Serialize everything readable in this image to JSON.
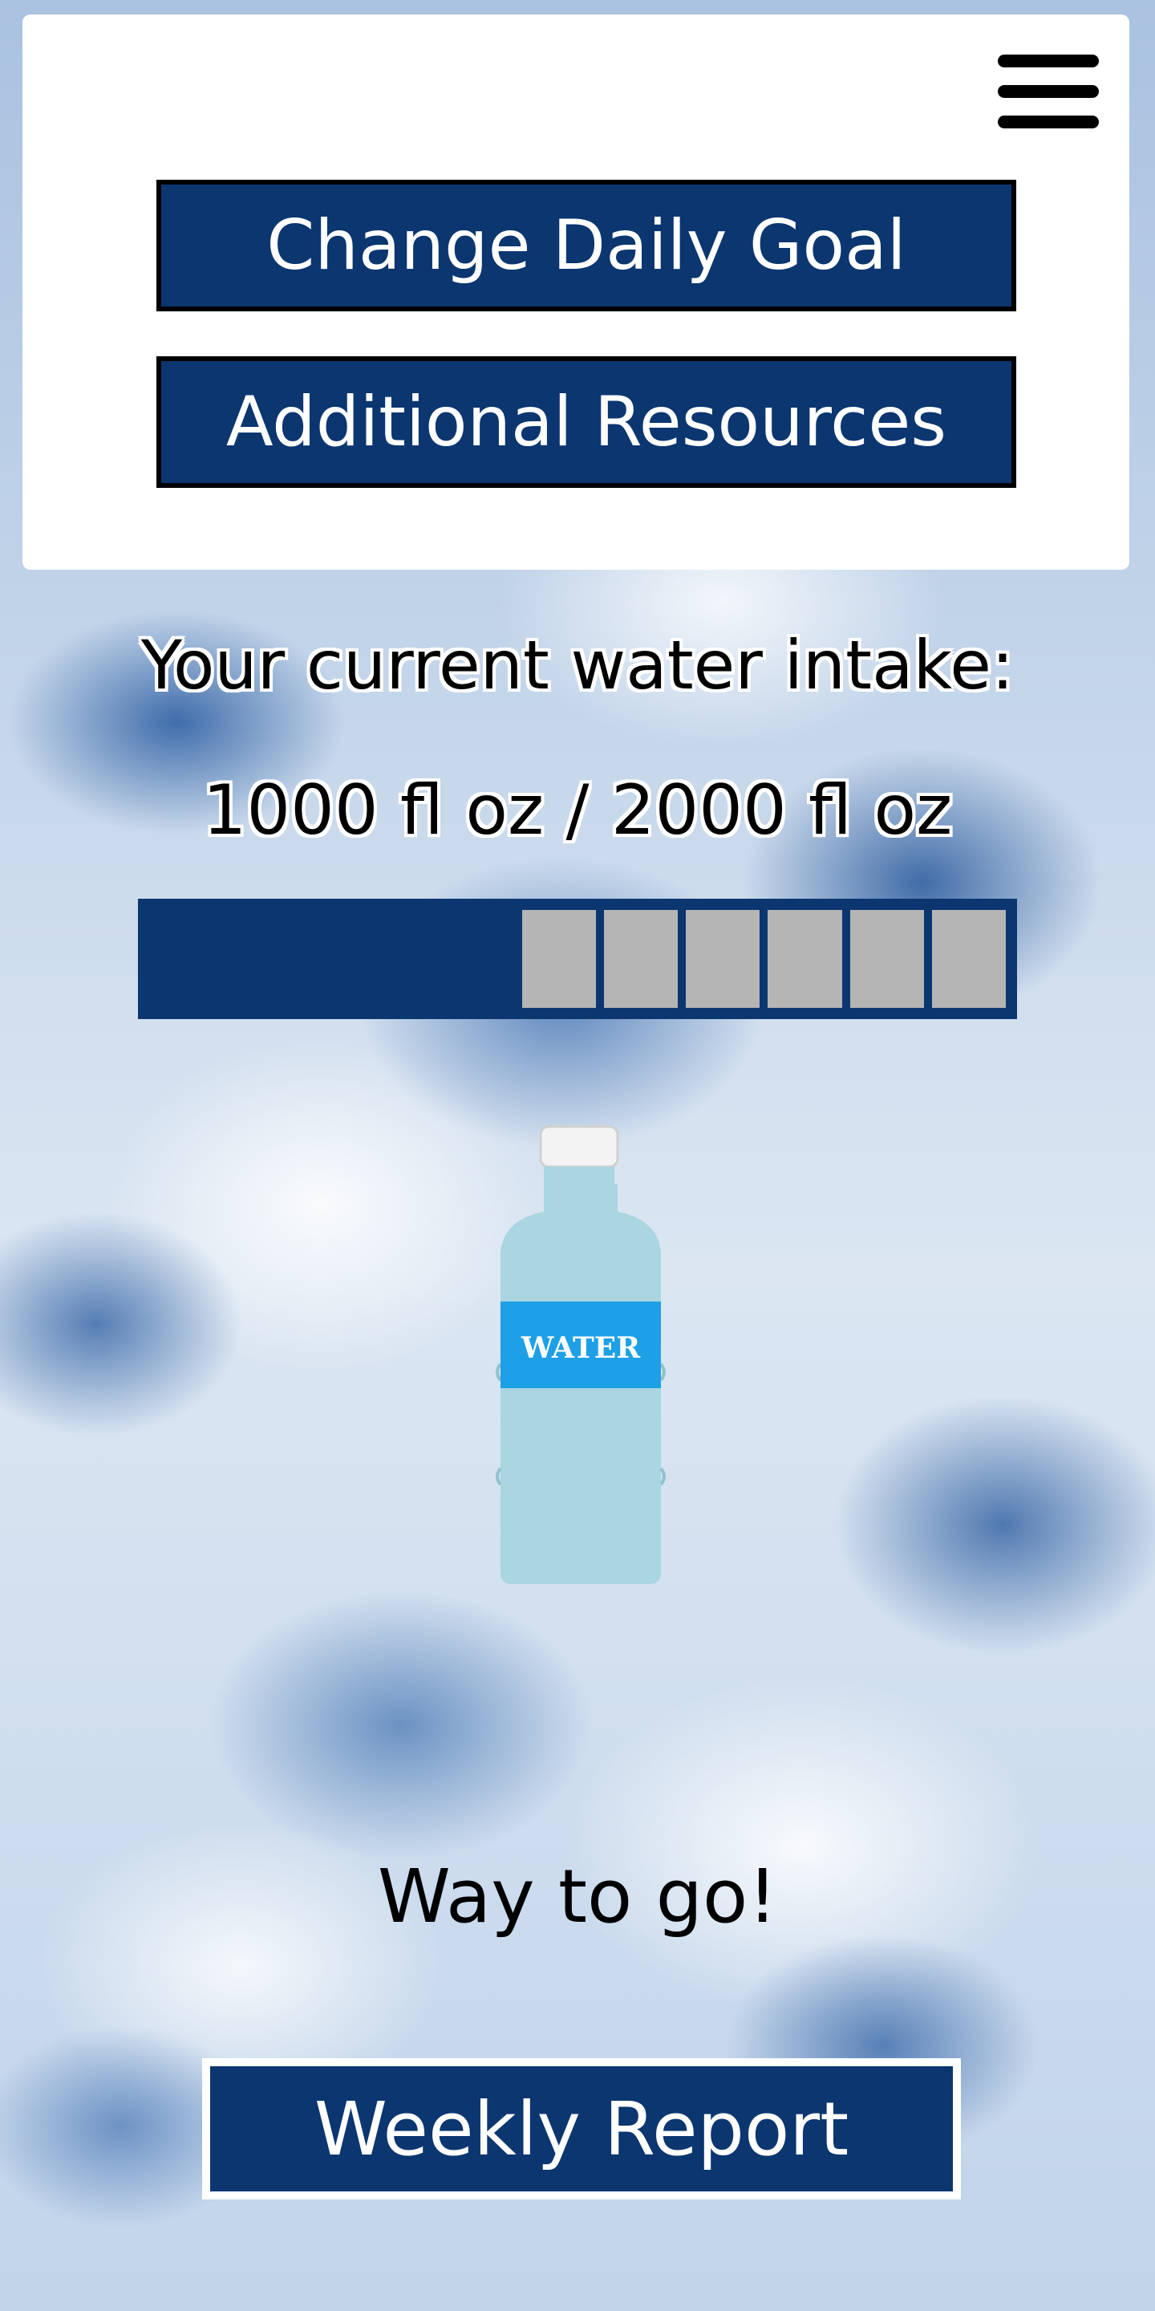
{
  "menu": {
    "icon": "hamburger-menu-icon",
    "change_goal_label": "Change Daily Goal",
    "resources_label": "Additional Resources"
  },
  "intake": {
    "title": "Your current water intake:",
    "value_text": "1000 fl oz / 2000 fl oz",
    "current": 1000,
    "goal": 2000,
    "unit": "fl oz",
    "progress_fraction": 0.5,
    "remaining_segments": 6
  },
  "bottle": {
    "icon": "water-bottle-icon",
    "label": "WATER"
  },
  "praise": "Way to go!",
  "weekly_report_label": "Weekly Report",
  "colors": {
    "navy": "#0b3670",
    "empty_segment": "#b5b5b5",
    "bottle_body": "#a9d6e0",
    "bottle_label": "#1ea0e6"
  }
}
